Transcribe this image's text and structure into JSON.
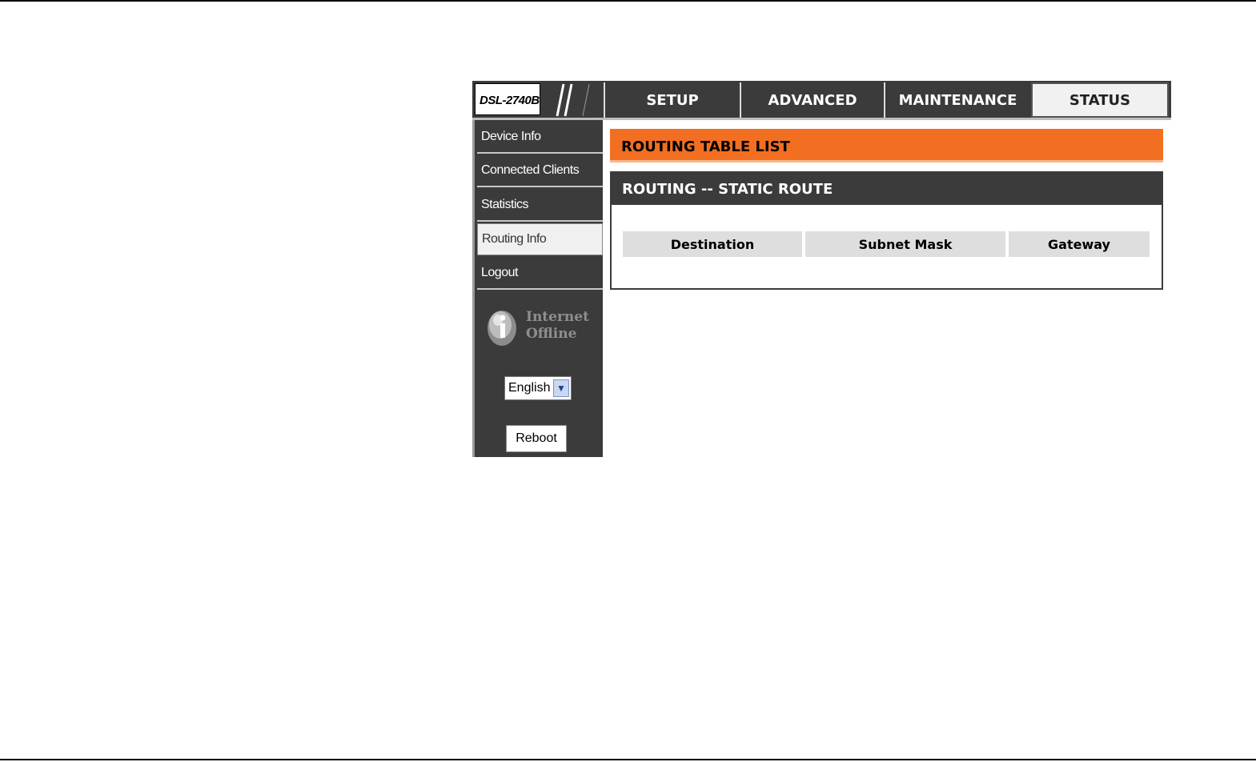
{
  "header": {
    "model": "DSL-2740B",
    "tabs": [
      {
        "label": "SETUP"
      },
      {
        "label": "ADVANCED"
      },
      {
        "label": "MAINTENANCE"
      },
      {
        "label": "STATUS",
        "active": true
      }
    ]
  },
  "sidebar": {
    "items": [
      {
        "label": "Device Info"
      },
      {
        "label": "Connected Clients"
      },
      {
        "label": "Statistics"
      },
      {
        "label": "Routing Info",
        "active": true
      },
      {
        "label": "Logout"
      }
    ],
    "internet_status": {
      "line1": "Internet",
      "line2": "Offline",
      "icon": "info-icon"
    },
    "language": {
      "selected": "English"
    },
    "reboot_label": "Reboot"
  },
  "main": {
    "page_title": "ROUTING TABLE LIST",
    "section_title": "ROUTING -- STATIC ROUTE",
    "table": {
      "columns": [
        "Destination",
        "Subnet Mask",
        "Gateway"
      ],
      "rows": []
    }
  },
  "colors": {
    "accent": "#f26f21",
    "dark": "#3b3b3b",
    "header_cell": "#dedede"
  }
}
